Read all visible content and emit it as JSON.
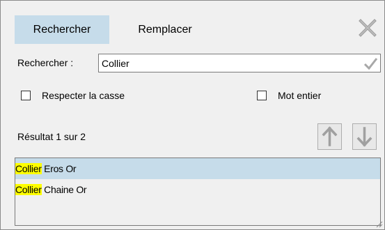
{
  "tabs": [
    {
      "label": "Rechercher",
      "active": true
    },
    {
      "label": "Remplacer",
      "active": false
    }
  ],
  "icons": {
    "close": "close-icon",
    "confirm": "checkmark-icon",
    "up": "arrow-up-icon",
    "down": "arrow-down-icon",
    "grip": "resize-grip-icon"
  },
  "search": {
    "label": "Rechercher :",
    "value": "Collier"
  },
  "options": {
    "match_case": {
      "label": "Respecter la casse",
      "checked": false
    },
    "whole_word": {
      "label": "Mot entier",
      "checked": false
    }
  },
  "result_status": "Résultat 1 sur 2",
  "results": [
    {
      "highlight": "Collier",
      "rest": " Eros Or",
      "selected": true
    },
    {
      "highlight": "Collier",
      "rest": " Chaine Or",
      "selected": false
    }
  ],
  "colors": {
    "selection": "#c6dcea",
    "highlight": "#ffff00",
    "background": "#f0f0f0"
  }
}
